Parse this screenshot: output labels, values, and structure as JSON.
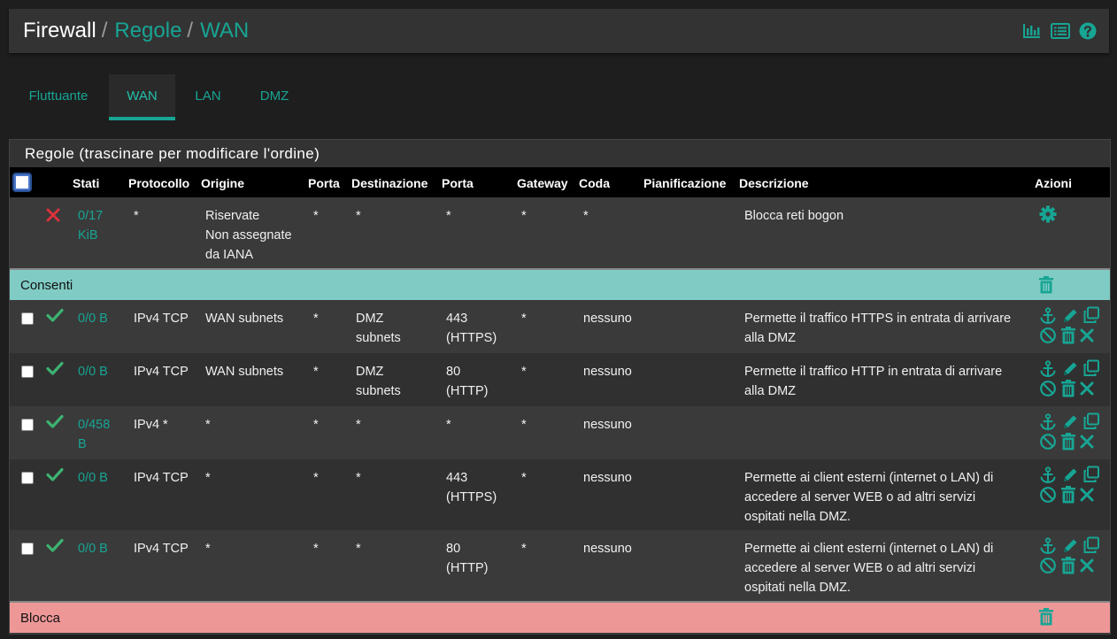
{
  "breadcrumb": {
    "root": "Firewall",
    "sep1": "/",
    "level1": "Regole",
    "sep2": "/",
    "level2": "WAN"
  },
  "header_icons": [
    "chart-icon",
    "list-icon",
    "help-icon"
  ],
  "tabs": [
    {
      "label": "Fluttuante",
      "active": false
    },
    {
      "label": "WAN",
      "active": true
    },
    {
      "label": "LAN",
      "active": false
    },
    {
      "label": "DMZ",
      "active": false
    }
  ],
  "panel": {
    "title": "Regole (trascinare per modificare l'ordine)"
  },
  "columns": {
    "stati": "Stati",
    "protocollo": "Protocollo",
    "origine": "Origine",
    "porta": "Porta",
    "destinazione": "Destinazione",
    "porta2": "Porta",
    "gateway": "Gateway",
    "coda": "Coda",
    "pianificazione": "Pianificazione",
    "descrizione": "Descrizione",
    "azioni": "Azioni"
  },
  "bogon_rule": {
    "status_icon": "close-icon",
    "states_1": "0/17",
    "states_2": "KiB",
    "protocol": "*",
    "source_1": "Riservate",
    "source_2": "Non assegnate",
    "source_3": "da IANA",
    "src_port": "*",
    "destination": "*",
    "dst_port": "*",
    "gateway": "*",
    "queue": "*",
    "description": "Blocca reti bogon",
    "action_icon": "gear-icon"
  },
  "separators": {
    "allow": "Consenti",
    "block": "Blocca"
  },
  "rules": [
    {
      "states": "0/0 B",
      "protocol": "IPv4 TCP",
      "source": "WAN subnets",
      "src_port": "*",
      "destination": "DMZ subnets",
      "dst_port": "443 (HTTPS)",
      "gateway": "*",
      "queue": "nessuno",
      "description": "Permette il traffico HTTPS in entrata di arrivare alla DMZ"
    },
    {
      "states": "0/0 B",
      "protocol": "IPv4 TCP",
      "source": "WAN subnets",
      "src_port": "*",
      "destination": "DMZ subnets",
      "dst_port": "80 (HTTP)",
      "gateway": "*",
      "queue": "nessuno",
      "description": "Permette il traffico HTTP in entrata di arrivare alla DMZ"
    },
    {
      "states": "0/458 B",
      "protocol": "IPv4 *",
      "source": "*",
      "src_port": "*",
      "destination": "*",
      "dst_port": "*",
      "gateway": "*",
      "queue": "nessuno",
      "description": ""
    },
    {
      "states": "0/0 B",
      "protocol": "IPv4 TCP",
      "source": "*",
      "src_port": "*",
      "destination": "*",
      "dst_port": "443 (HTTPS)",
      "gateway": "*",
      "queue": "nessuno",
      "description": "Permette ai client esterni (internet o LAN) di accedere al server WEB o ad altri servizi ospitati nella DMZ."
    },
    {
      "states": "0/0 B",
      "protocol": "IPv4 TCP",
      "source": "*",
      "src_port": "*",
      "destination": "*",
      "dst_port": "80 (HTTP)",
      "gateway": "*",
      "queue": "nessuno",
      "description": "Permette ai client esterni (internet o LAN) di accedere al server WEB o ad altri servizi ospitati nella DMZ."
    }
  ],
  "colors": {
    "accent": "#17a594",
    "pass": "#3cb371",
    "block": "#d9323a",
    "allow_bg": "#80ccc4",
    "block_bg": "#ee9797"
  }
}
